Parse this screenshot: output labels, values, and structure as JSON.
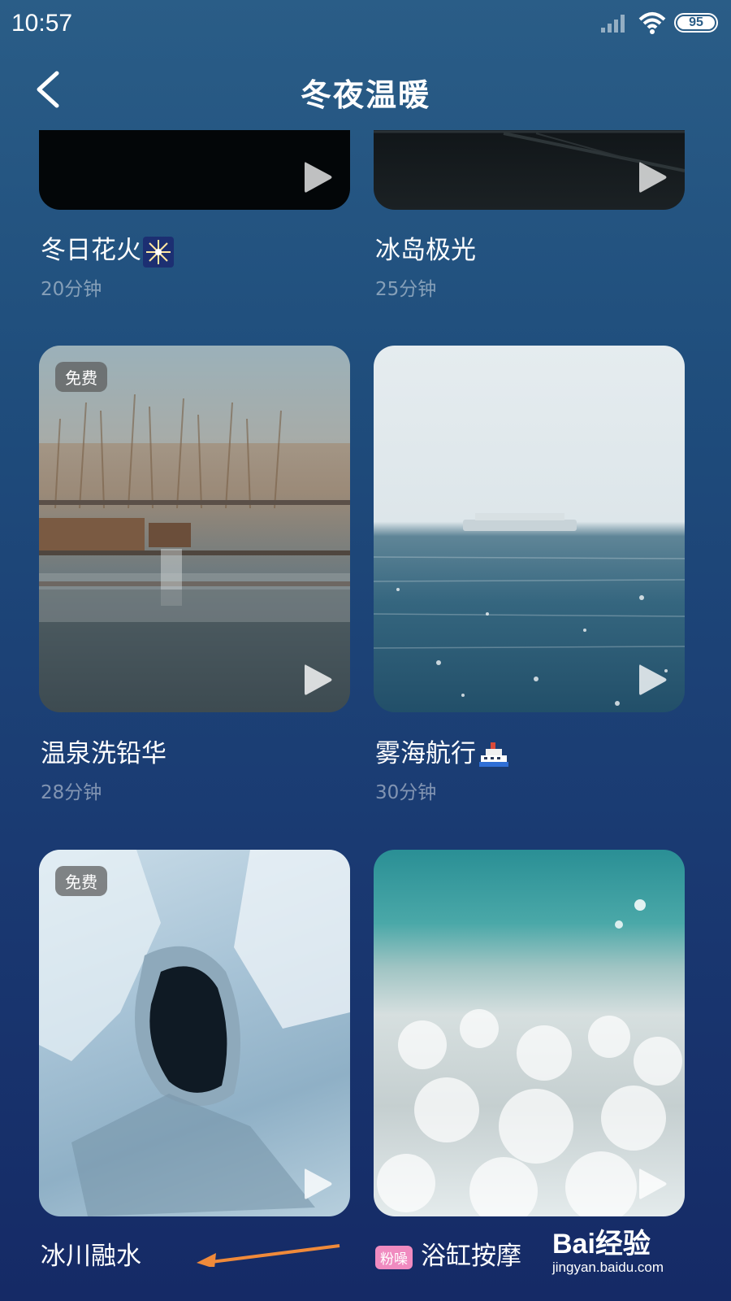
{
  "status": {
    "time": "10:57",
    "battery": "95"
  },
  "header": {
    "title": "冬夜温暖"
  },
  "cards": [
    {
      "title": "冬日花火",
      "duration": "20分钟",
      "emoji": "sparkler-icon"
    },
    {
      "title": "冰岛极光",
      "duration": "25分钟"
    },
    {
      "title": "温泉洗铅华",
      "duration": "28分钟",
      "badge": "免费"
    },
    {
      "title": "雾海航行",
      "duration": "30分钟",
      "emoji": "ship-icon"
    },
    {
      "title": "冰川融水",
      "badge": "免费"
    },
    {
      "title": "浴缸按摩",
      "tag": "粉噪"
    }
  ],
  "watermark": {
    "brand": "Bai经验",
    "url": "jingyan.baidu.com"
  },
  "colors": {
    "accent_pink": "#f08bc0",
    "annotation_arrow": "#f08a3a"
  }
}
